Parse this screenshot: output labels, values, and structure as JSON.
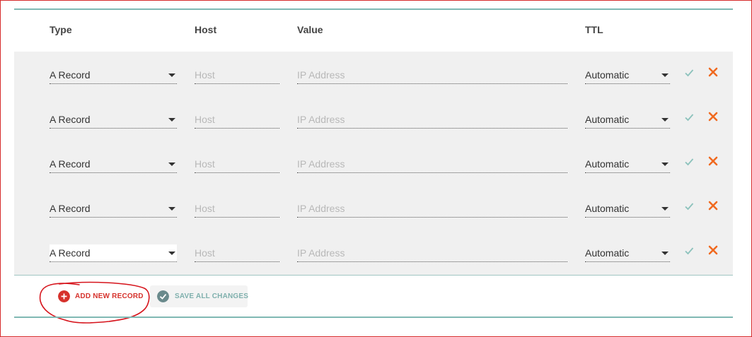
{
  "table": {
    "headers": {
      "type": "Type",
      "host": "Host",
      "value": "Value",
      "ttl": "TTL"
    }
  },
  "records": [
    {
      "type": "A Record",
      "host_placeholder": "Host",
      "value_placeholder": "IP Address",
      "ttl": "Automatic"
    },
    {
      "type": "A Record",
      "host_placeholder": "Host",
      "value_placeholder": "IP Address",
      "ttl": "Automatic"
    },
    {
      "type": "A Record",
      "host_placeholder": "Host",
      "value_placeholder": "IP Address",
      "ttl": "Automatic"
    },
    {
      "type": "A Record",
      "host_placeholder": "Host",
      "value_placeholder": "IP Address",
      "ttl": "Automatic"
    },
    {
      "type": "A Record",
      "host_placeholder": "Host",
      "value_placeholder": "IP Address",
      "ttl": "Automatic"
    }
  ],
  "actions": {
    "add_new_record": "ADD NEW RECORD",
    "save_all_changes": "SAVE ALL CHANGES"
  },
  "colors": {
    "accent_teal": "#7fb8b3",
    "check_green": "#8cc2bc",
    "delete_orange": "#f06a20",
    "add_red": "#d6322c",
    "save_gray_teal": "#6a8a8c",
    "annotation_red": "#d6141c",
    "frame_red": "#d62b2b"
  },
  "icons": {
    "confirm": "check-icon",
    "delete": "close-icon",
    "add": "plus-circle-icon",
    "save": "check-circle-icon",
    "dropdown": "caret-down-icon"
  }
}
